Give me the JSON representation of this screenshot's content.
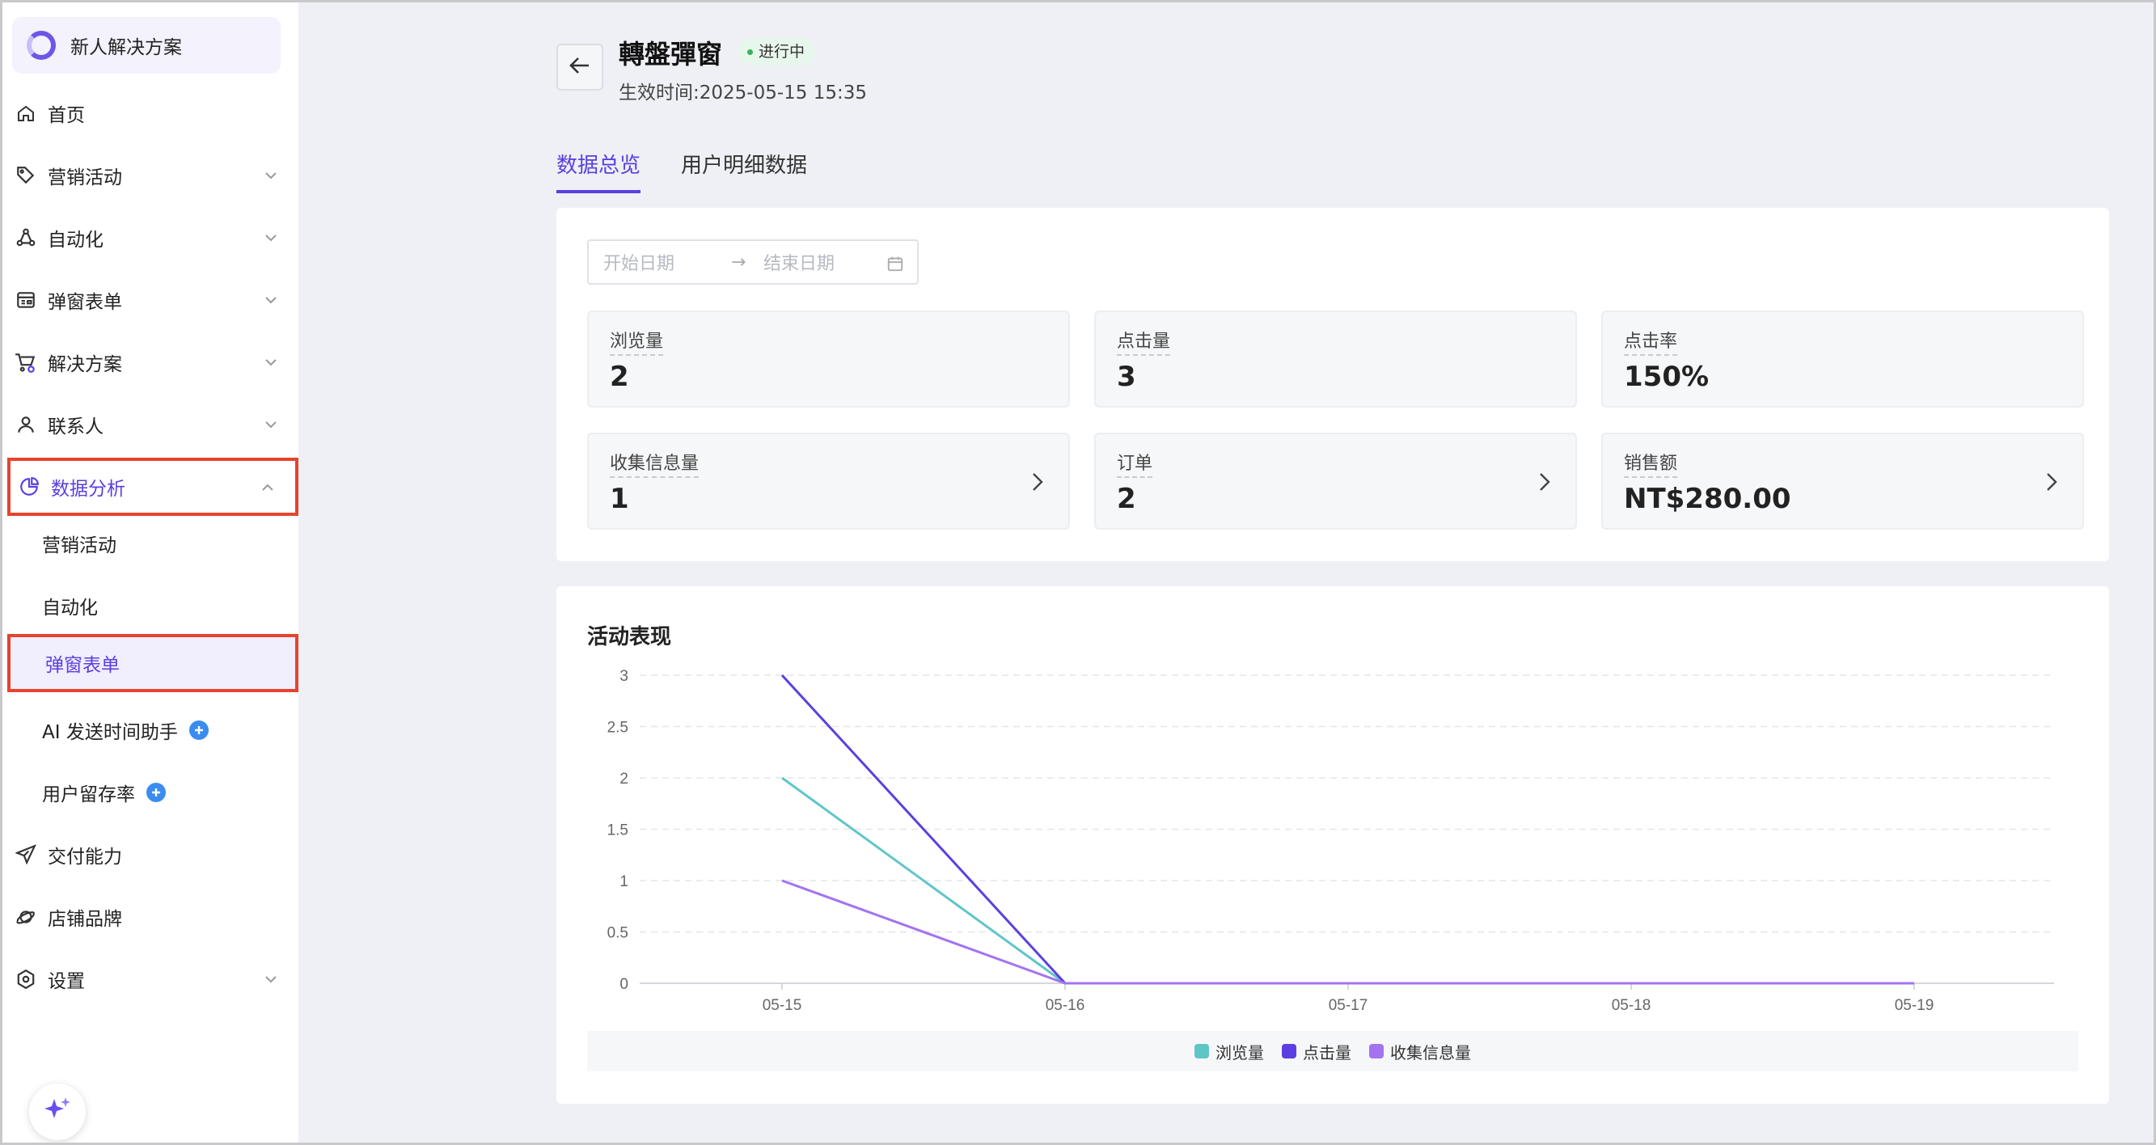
{
  "sidebar": {
    "brand": "新人解决方案",
    "items": [
      {
        "label": "首页",
        "icon": "home-icon"
      },
      {
        "label": "营销活动",
        "icon": "tag-icon"
      },
      {
        "label": "自动化",
        "icon": "automation-icon"
      },
      {
        "label": "弹窗表单",
        "icon": "form-icon"
      },
      {
        "label": "解决方案",
        "icon": "cart-icon"
      },
      {
        "label": "联系人",
        "icon": "user-icon"
      },
      {
        "label": "数据分析",
        "icon": "pie-chart-icon",
        "expanded": true
      },
      {
        "label": "交付能力",
        "icon": "send-icon"
      },
      {
        "label": "店铺品牌",
        "icon": "planet-icon"
      },
      {
        "label": "设置",
        "icon": "settings-icon"
      }
    ],
    "sub_items": [
      {
        "label": "营销活动"
      },
      {
        "label": "自动化"
      },
      {
        "label": "弹窗表单",
        "active": true
      },
      {
        "label": "AI 发送时间助手",
        "badge": "new"
      },
      {
        "label": "用户留存率",
        "badge": "new"
      }
    ]
  },
  "header": {
    "title": "轉盤彈窗",
    "status": "进行中",
    "effective_time": "生效时间:2025-05-15 15:35"
  },
  "tabs": [
    {
      "label": "数据总览",
      "active": true
    },
    {
      "label": "用户明细数据",
      "active": false
    }
  ],
  "filters": {
    "start_placeholder": "开始日期",
    "end_placeholder": "结束日期",
    "separator": "→"
  },
  "stats": [
    {
      "label": "浏览量",
      "value": "2"
    },
    {
      "label": "点击量",
      "value": "3"
    },
    {
      "label": "点击率",
      "value": "150%"
    },
    {
      "label": "收集信息量",
      "value": "1",
      "link": true
    },
    {
      "label": "订单",
      "value": "2",
      "link": true
    },
    {
      "label": "销售额",
      "value": "NT$280.00",
      "link": true
    }
  ],
  "chart_data": {
    "type": "line",
    "title": "活动表现",
    "x": [
      "05-15",
      "05-16",
      "05-17",
      "05-18",
      "05-19"
    ],
    "series": [
      {
        "name": "浏览量",
        "color": "#5fc6c8",
        "values": [
          2,
          0,
          0,
          0,
          0
        ]
      },
      {
        "name": "点击量",
        "color": "#5b3fe0",
        "values": [
          3,
          0,
          0,
          0,
          0
        ]
      },
      {
        "name": "收集信息量",
        "color": "#a373f0",
        "values": [
          1,
          0,
          0,
          0,
          0
        ]
      }
    ],
    "ylim": [
      0,
      3
    ],
    "yticks": [
      "0",
      "0.5",
      "1",
      "1.5",
      "2",
      "2.5",
      "3"
    ],
    "grid": true,
    "legend": "bottom"
  },
  "colors": {
    "accent": "#5b3fe0",
    "highlight_border": "#e5442e"
  }
}
